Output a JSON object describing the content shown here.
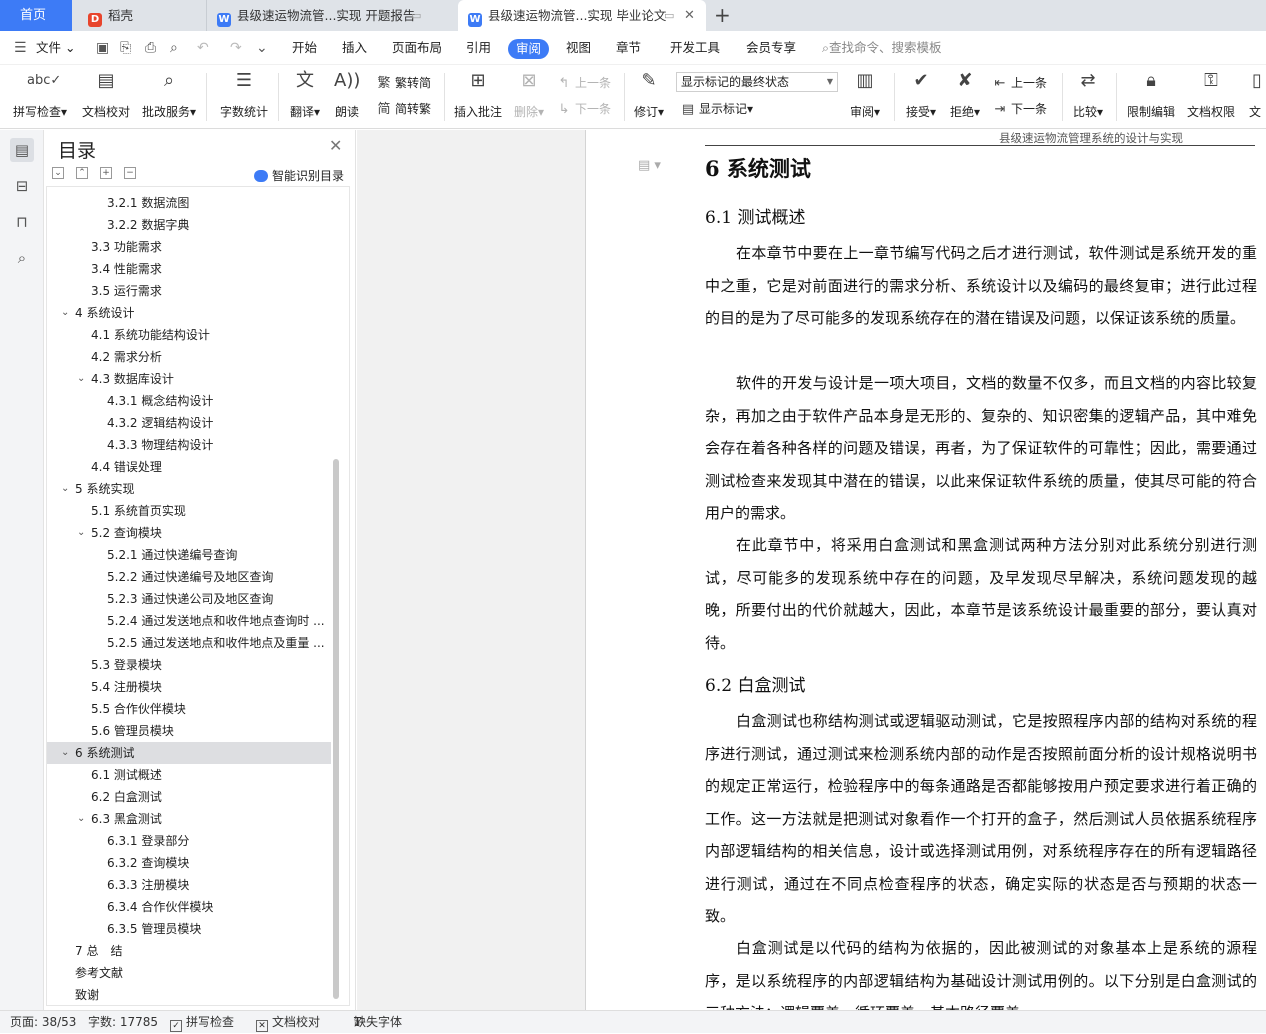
{
  "tabs": {
    "home": "首页",
    "daoke": "稻壳",
    "doc1": "县级速运物流管...实现 开题报告",
    "doc2": "县级速运物流管...实现 毕业论文",
    "add": "+"
  },
  "menu": {
    "file": "文件",
    "items": [
      "开始",
      "插入",
      "页面布局",
      "引用",
      "审阅",
      "视图",
      "章节",
      "开发工具",
      "会员专享"
    ],
    "active": "审阅",
    "search": "查找命令、搜索模板"
  },
  "ribbon": {
    "spell": "拼写检查",
    "proof": "文档校对",
    "service": "批改服务",
    "wordcount": "字数统计",
    "translate": "翻译",
    "read": "朗读",
    "t2s": "繁转简",
    "s2t": "简转繁",
    "insert_comment": "插入批注",
    "delete": "删除",
    "prev_comment": "上一条",
    "next_comment": "下一条",
    "revise": "修订",
    "markup_select": "显示标记的最终状态",
    "show_markup": "显示标记",
    "review": "审阅",
    "accept": "接受",
    "reject": "拒绝",
    "prev": "上一条",
    "next": "下一条",
    "compare": "比较",
    "restrict": "限制编辑",
    "permission": "文档权限",
    "more": "文"
  },
  "toc": {
    "title": "目录",
    "smart": "智能识别目录",
    "items": [
      {
        "label": "3.2.1 数据流图",
        "level": 3,
        "caret": ""
      },
      {
        "label": "3.2.2 数据字典",
        "level": 3,
        "caret": ""
      },
      {
        "label": "3.3 功能需求",
        "level": 2,
        "caret": ""
      },
      {
        "label": "3.4 性能需求",
        "level": 2,
        "caret": ""
      },
      {
        "label": "3.5 运行需求",
        "level": 2,
        "caret": ""
      },
      {
        "label": "4 系统设计",
        "level": 1,
        "caret": "v"
      },
      {
        "label": "4.1 系统功能结构设计",
        "level": 2,
        "caret": ""
      },
      {
        "label": "4.2 需求分析",
        "level": 2,
        "caret": ""
      },
      {
        "label": "4.3 数据库设计",
        "level": 2,
        "caret": "v"
      },
      {
        "label": "4.3.1 概念结构设计",
        "level": 3,
        "caret": ""
      },
      {
        "label": "4.3.2 逻辑结构设计",
        "level": 3,
        "caret": ""
      },
      {
        "label": "4.3.3 物理结构设计",
        "level": 3,
        "caret": ""
      },
      {
        "label": "4.4 错误处理",
        "level": 2,
        "caret": ""
      },
      {
        "label": "5 系统实现",
        "level": 1,
        "caret": "v"
      },
      {
        "label": "5.1 系统首页实现",
        "level": 2,
        "caret": ""
      },
      {
        "label": "5.2 查询模块",
        "level": 2,
        "caret": "v"
      },
      {
        "label": "5.2.1 通过快递编号查询",
        "level": 3,
        "caret": ""
      },
      {
        "label": "5.2.2 通过快递编号及地区查询",
        "level": 3,
        "caret": ""
      },
      {
        "label": "5.2.3 通过快递公司及地区查询",
        "level": 3,
        "caret": ""
      },
      {
        "label": "5.2.4 通过发送地点和收件地点查询时 ...",
        "level": 3,
        "caret": ""
      },
      {
        "label": "5.2.5 通过发送地点和收件地点及重量 ...",
        "level": 3,
        "caret": ""
      },
      {
        "label": "5.3 登录模块",
        "level": 2,
        "caret": ""
      },
      {
        "label": "5.4 注册模块",
        "level": 2,
        "caret": ""
      },
      {
        "label": "5.5 合作伙伴模块",
        "level": 2,
        "caret": ""
      },
      {
        "label": "5.6 管理员模块",
        "level": 2,
        "caret": ""
      },
      {
        "label": "6 系统测试",
        "level": 1,
        "caret": "v",
        "selected": true
      },
      {
        "label": "6.1 测试概述",
        "level": 2,
        "caret": ""
      },
      {
        "label": "6.2 白盒测试",
        "level": 2,
        "caret": ""
      },
      {
        "label": "6.3 黑盒测试",
        "level": 2,
        "caret": "v"
      },
      {
        "label": "6.3.1 登录部分",
        "level": 3,
        "caret": ""
      },
      {
        "label": "6.3.2 查询模块",
        "level": 3,
        "caret": ""
      },
      {
        "label": "6.3.3 注册模块",
        "level": 3,
        "caret": ""
      },
      {
        "label": "6.3.4 合作伙伴模块",
        "level": 3,
        "caret": ""
      },
      {
        "label": "6.3.5 管理员模块",
        "level": 3,
        "caret": ""
      },
      {
        "label": "7 总　结",
        "level": 1,
        "caret": ""
      },
      {
        "label": "参考文献",
        "level": 1,
        "caret": ""
      },
      {
        "label": "致谢",
        "level": 1,
        "caret": ""
      }
    ]
  },
  "doc": {
    "header_text": "县级速运物流管理系统的设计与实现",
    "h1": "6 系统测试",
    "h2_1": "6.1 测试概述",
    "p1": "在本章节中要在上一章节编写代码之后才进行测试，软件测试是系统开发的重中之重，它是对前面进行的需求分析、系统设计以及编码的最终复审；进行此过程的目的是为了尽可能多的发现系统存在的潜在错误及问题，以保证该系统的质量。",
    "p2": "软件的开发与设计是一项大项目，文档的数量不仅多，而且文档的内容比较复杂，再加之由于软件产品本身是无形的、复杂的、知识密集的逻辑产品，其中难免会存在着各种各样的问题及错误，再者，为了保证软件的可靠性；因此，需要通过测试检查来发现其中潜在的错误，以此来保证软件系统的质量，使其尽可能的符合用户的需求。",
    "p3": "在此章节中，将采用白盒测试和黑盒测试两种方法分别对此系统分别进行测试，尽可能多的发现系统中存在的问题，及早发现尽早解决，系统问题发现的越晚，所要付出的代价就越大，因此，本章节是该系统设计最重要的部分，要认真对待。",
    "h2_2": "6.2 白盒测试",
    "p4": "白盒测试也称结构测试或逻辑驱动测试，它是按照程序内部的结构对系统的程序进行测试，通过测试来检测系统内部的动作是否按照前面分析的设计规格说明书的规定正常运行，检验程序中的每条通路是否都能够按用户预定要求进行着正确的工作。这一方法就是把测试对象看作一个打开的盒子，然后测试人员依据系统程序内部逻辑结构的相关信息，设计或选择测试用例，对系统程序存在的所有逻辑路径进行测试，通过在不同点检查程序的状态，确定实际的状态是否与预期的状态一致。",
    "p5": "白盒测试是以代码的结构为依据的，因此被测试的对象基本上是系统的源程序，是以系统程序的内部逻辑结构为基础设计测试用例的。以下分别是白盒测试的三种方法：逻辑覆盖、循环覆盖、基本路径覆盖。"
  },
  "status": {
    "page": "页面: 38/53",
    "words": "字数: 17785",
    "spell": "拼写检查",
    "proof": "文档校对",
    "missing_font": "缺失字体"
  }
}
